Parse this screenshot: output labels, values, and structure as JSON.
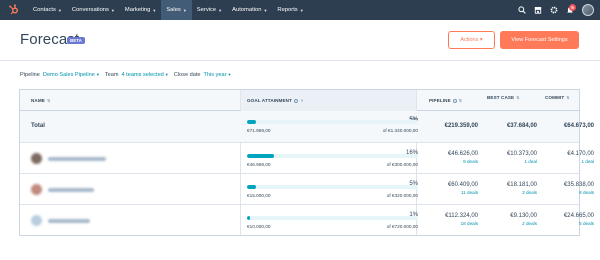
{
  "nav": {
    "items": [
      {
        "label": "Contacts",
        "active": false
      },
      {
        "label": "Conversations",
        "active": false
      },
      {
        "label": "Marketing",
        "active": false
      },
      {
        "label": "Sales",
        "active": true
      },
      {
        "label": "Service",
        "active": false
      },
      {
        "label": "Automation",
        "active": false
      },
      {
        "label": "Reports",
        "active": false
      }
    ],
    "notification_count": "5",
    "icons": [
      "search-icon",
      "marketplace-icon",
      "settings-icon",
      "notifications-icon"
    ]
  },
  "header": {
    "title": "Forecast",
    "badge": "BETA",
    "actions_label": "Actions ▾",
    "settings_label": "View Forecast Settings"
  },
  "filters": {
    "pipeline_label": "Pipeline",
    "pipeline_value": "Demo Sales Pipeline",
    "team_label": "Team",
    "team_value": "4 teams selected",
    "close_date_label": "Close date",
    "close_date_value": "This year"
  },
  "table": {
    "columns": {
      "name": "NAME",
      "goal": "GOAL ATTAINMENT",
      "pipeline": "PIPELINE",
      "best_case": "BEST CASE",
      "commit": "COMMIT"
    },
    "rows": [
      {
        "name": "Total",
        "pct": "5%",
        "progress": 0.05,
        "attained": "€71.959,00",
        "goal": "of €1.340.000,00",
        "pipeline": "€219.359,00",
        "pipeline_deals": "",
        "best_case": "€37.684,00",
        "best_case_deals": "",
        "commit": "€64.673,00",
        "commit_deals": ""
      },
      {
        "name": "",
        "pct": "16%",
        "progress": 0.16,
        "attained": "€46.959,00",
        "goal": "of €300.000,00",
        "pipeline": "€46.626,00",
        "pipeline_deals": "9 deals",
        "best_case": "€10.373,00",
        "best_case_deals": "1 deal",
        "commit": "€4.170,00",
        "commit_deals": "1 deal"
      },
      {
        "name": "",
        "pct": "5%",
        "progress": 0.05,
        "attained": "€15.000,00",
        "goal": "of €320.000,00",
        "pipeline": "€60.409,00",
        "pipeline_deals": "11 deals",
        "best_case": "€18.181,00",
        "best_case_deals": "3 deals",
        "commit": "€35.838,00",
        "commit_deals": "8 deals"
      },
      {
        "name": "",
        "pct": "1%",
        "progress": 0.01,
        "attained": "€10.000,00",
        "goal": "of €720.000,00",
        "pipeline": "€112.324,00",
        "pipeline_deals": "18 deals",
        "best_case": "€9.130,00",
        "best_case_deals": "2 deals",
        "commit": "€24.665,00",
        "commit_deals": "5 deals"
      }
    ]
  },
  "colors": {
    "nav_bg": "#2d3e50",
    "accent_orange": "#ff7a59",
    "link_teal": "#0091ae",
    "progress": "#00a4bd",
    "beta": "#6a78d1"
  }
}
